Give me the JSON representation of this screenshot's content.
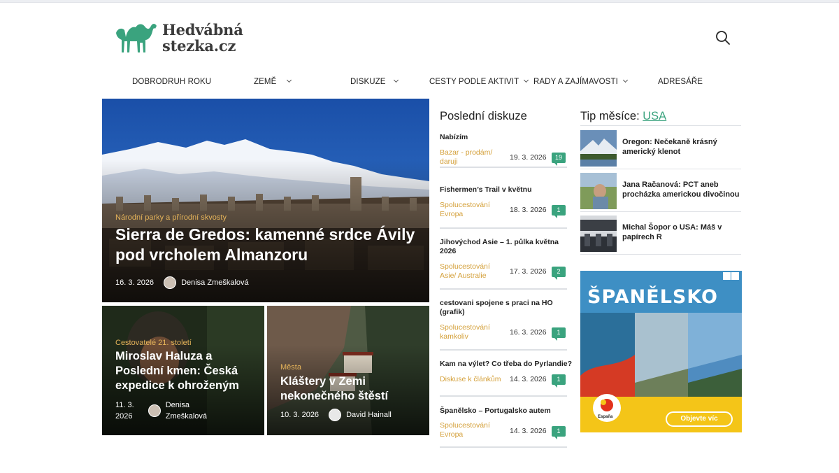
{
  "site": {
    "logo_line1": "Hedvábná",
    "logo_line2": "stezka.cz",
    "accent": "#3aa37e",
    "gold": "#d4a03a"
  },
  "nav": {
    "items": [
      {
        "label": "DOBRODRUH ROKU",
        "has_dropdown": false
      },
      {
        "label": "ZEMĚ",
        "has_dropdown": true
      },
      {
        "label": "DISKUZE",
        "has_dropdown": true
      },
      {
        "label": "CESTY PODLE AKTIVIT",
        "has_dropdown": true
      },
      {
        "label": "RADY A ZAJÍMAVOSTI",
        "has_dropdown": true
      },
      {
        "label": "ADRESÁŘE",
        "has_dropdown": false
      }
    ]
  },
  "hero": {
    "category": "Národní parky a přírodní skvosty",
    "title_line1": "Sierra de Gredos: kamenné srdce Ávily",
    "title_line2": "pod vrcholem Almanzoru",
    "date": "16. 3. 2026",
    "author": "Denisa Zmeškalová"
  },
  "cards": [
    {
      "category": "Cestovatelé 21. století",
      "title_line1": "Miroslav Haluza a",
      "title_line2": "Poslední kmen: Česká",
      "title_line3": "expedice k ohroženým",
      "date_line1": "11. 3.",
      "date_line2": "2026",
      "author_line1": "Denisa",
      "author_line2": "Zmeškalová"
    },
    {
      "category": "Města",
      "title_line1": "Kláštery v Zemi",
      "title_line2": "nekonečného štěstí",
      "date": "10. 3. 2026",
      "author": "David Hainall"
    }
  ],
  "discussions": {
    "heading": "Poslední diskuze",
    "items": [
      {
        "title": "Nabízím",
        "category": "Bazar - prodám/ daruji",
        "date": "19. 3. 2026",
        "count": "19"
      },
      {
        "title": "Fishermen’s Trail v květnu",
        "category": "Spolucestování Evropa",
        "date": "18. 3. 2026",
        "count": "1"
      },
      {
        "title": "Jihovýchod Asie – 1. půlka května 2026",
        "category": "Spolucestování Asie/ Australie",
        "date": "17. 3. 2026",
        "count": "2"
      },
      {
        "title": "cestovani spojene s praci na HO (grafik)",
        "category": "Spolucestování kamkoliv",
        "date": "16. 3. 2026",
        "count": "1"
      },
      {
        "title": "Kam na výlet? Co třeba do Pyrlandie?",
        "category": "Diskuse k článkům",
        "date": "14. 3. 2026",
        "count": "1"
      },
      {
        "title": "Španělsko – Portugalsko autem",
        "category": "Spolucestování Evropa",
        "date": "14. 3. 2026",
        "count": "1"
      }
    ]
  },
  "tip": {
    "heading": "Tip měsíce:",
    "country": "USA",
    "items": [
      {
        "title": "Oregon: Nečekaně krásný americký klenot"
      },
      {
        "title": "Jana Račanová: PCT aneb procházka americkou divočinou"
      },
      {
        "title": "Michal Šopor o USA: Máš v papírech R"
      }
    ]
  },
  "ad": {
    "title": "ŠPANĚLSKO",
    "button": "Objevte víc",
    "logo_text": "España"
  }
}
